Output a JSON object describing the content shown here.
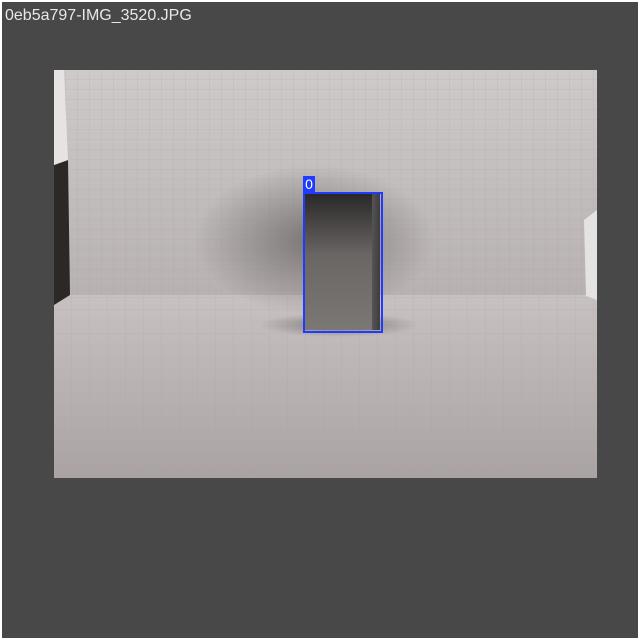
{
  "viewer": {
    "filename": "0eb5a797-IMG_3520.JPG",
    "background_color": "#484848"
  },
  "image": {
    "subject": "photo of a grey rectangular block on grid paper backdrop"
  },
  "detection": {
    "label": "0",
    "box_color": "#1f3bff"
  }
}
